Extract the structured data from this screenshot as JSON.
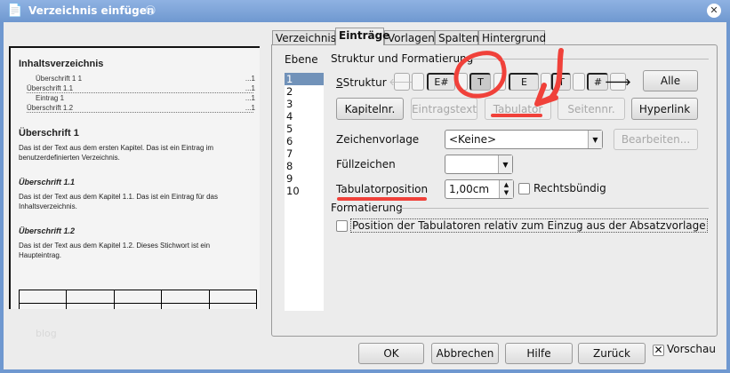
{
  "window": {
    "title": "Verzeichnis einfügen",
    "close_icon": "close-icon"
  },
  "preview": {
    "toc_title": "Inhaltsverzeichnis",
    "toc_entries": [
      {
        "text": "Überschrift 1   1",
        "page": "...1"
      },
      {
        "text": "Überschrift 1.1",
        "page": "...1"
      },
      {
        "text": "Eintrag 1",
        "page": "...1"
      },
      {
        "text": "Überschrift 1.2",
        "page": "...1"
      }
    ],
    "sections": [
      {
        "heading": "Überschrift 1",
        "body": "Das ist der Text aus dem ersten Kapitel. Das ist ein Eintrag im benutzerdefinierten Verzeichnis."
      },
      {
        "heading": "Überschrift 1.1",
        "body": "Das ist der Text aus dem Kapitel 1.1. Das ist ein Eintrag für das Inhaltsverzeichnis."
      },
      {
        "heading": "Überschrift 1.2",
        "body": "Das ist der Text aus dem Kapitel 1.2. Dieses Stichwort ist ein Haupteintrag."
      }
    ],
    "watermark": "blog"
  },
  "tabs": [
    "Verzeichnis",
    "Einträge",
    "Vorlagen",
    "Spalten",
    "Hintergrund"
  ],
  "active_tab": "Einträge",
  "ebene": {
    "label": "Ebene",
    "levels": [
      "1",
      "2",
      "3",
      "4",
      "5",
      "6",
      "7",
      "8",
      "9",
      "10"
    ],
    "selected": "1"
  },
  "struktur": {
    "group_label": "Struktur und Formatierung",
    "label": "Struktur",
    "tokens": [
      "E#",
      "T",
      "E",
      "T",
      "#"
    ],
    "alle": "Alle",
    "buttons": [
      "Kapitelnr.",
      "Eintragstext",
      "Tabulator",
      "Seitennr.",
      "Hyperlink"
    ]
  },
  "zeichenvorlage": {
    "label": "Zeichenvorlage",
    "value": "<Keine>",
    "edit": "Bearbeiten..."
  },
  "fuellzeichen": {
    "label": "Füllzeichen",
    "value": ""
  },
  "tabposition": {
    "label": "Tabulatorposition",
    "value": "1,00cm",
    "right_align_label": "Rechtsbündig",
    "right_align_checked": false
  },
  "formatierung": {
    "label": "Formatierung",
    "relative_label": "Position der Tabulatoren relativ zum Einzug aus der Absatzvorlage",
    "relative_checked": false
  },
  "footer": {
    "ok": "OK",
    "cancel": "Abbrechen",
    "help": "Hilfe",
    "back": "Zurück",
    "preview_label": "Vorschau",
    "preview_checked": true
  },
  "colors": {
    "title_bar": "#6f98d0",
    "selection": "#7192b9",
    "annotation": "#f0413a"
  }
}
